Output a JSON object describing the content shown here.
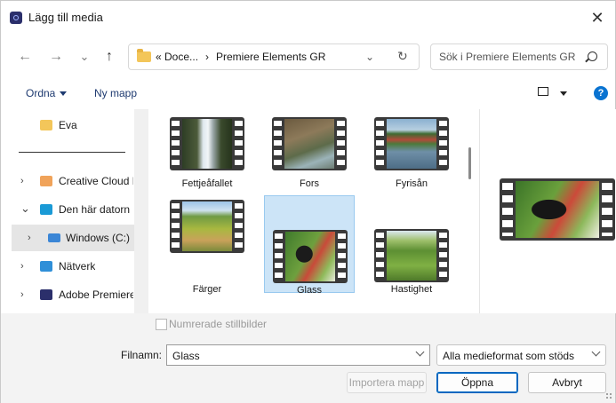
{
  "window": {
    "title": "Lägg till media",
    "close_glyph": "✕"
  },
  "nav": {
    "back_glyph": "←",
    "forward_glyph": "→",
    "recent_glyph": "⌄",
    "up_glyph": "↑",
    "breadcrumb": [
      "« Doce...",
      "›",
      "Premiere Elements GR"
    ],
    "address_dropdown_glyph": "⌄",
    "refresh_glyph": "↻",
    "search_placeholder": "Sök i Premiere Elements GR"
  },
  "command_bar": {
    "organize": "Ordna",
    "new_folder": "Ny mapp",
    "help": "?"
  },
  "sidebar": {
    "items": [
      {
        "label": "Eva",
        "icon": "folder-icon",
        "chevron": ""
      },
      {
        "label": "Creative Cloud F",
        "icon": "creative-cloud-icon",
        "chevron": "›"
      },
      {
        "label": "Den här datorn",
        "icon": "computer-icon",
        "chevron": "⌄"
      },
      {
        "label": "Windows (C:)",
        "icon": "drive-icon",
        "chevron": "›"
      },
      {
        "label": "Nätverk",
        "icon": "network-icon",
        "chevron": "›"
      },
      {
        "label": "Adobe Premiere",
        "icon": "premiere-icon",
        "chevron": "›"
      }
    ]
  },
  "files": [
    {
      "name": "Fettjeåfallet",
      "icon": "video-waterfall-icon"
    },
    {
      "name": "Fors",
      "icon": "video-rapids-icon"
    },
    {
      "name": "Fyrisån",
      "icon": "video-river-icon"
    },
    {
      "name": "Färger",
      "icon": "video-landscape-icon"
    },
    {
      "name": "Glass",
      "icon": "video-dog-icon"
    },
    {
      "name": "Hastighet",
      "icon": "video-meadow-icon"
    }
  ],
  "selected_file": "Glass",
  "options": {
    "numbered_stills": "Numrerade stillbilder"
  },
  "footer": {
    "filename_label": "Filnamn:",
    "filename_value": "Glass",
    "filter_value": "Alla medieformat som stöds",
    "import_folder": "Importera mapp",
    "open": "Öppna",
    "cancel": "Avbryt"
  },
  "colors": {
    "accent": "#0067c0",
    "selection": "#cce4f7",
    "link": "#1e3a70"
  }
}
